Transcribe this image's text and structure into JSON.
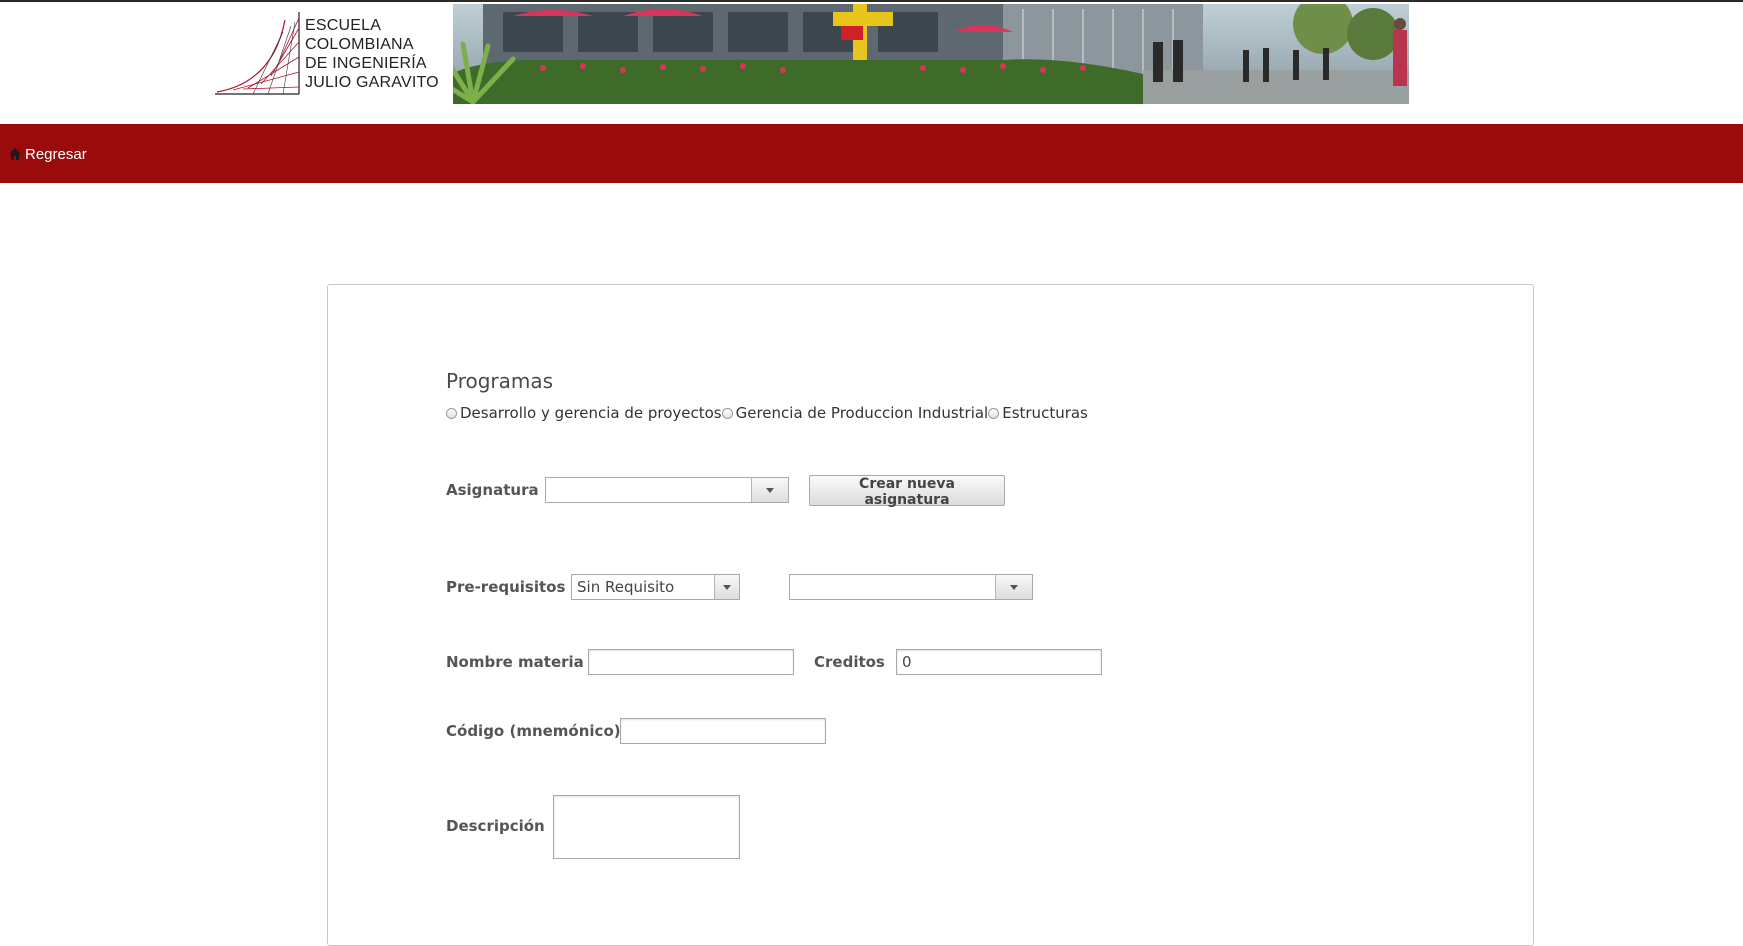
{
  "header": {
    "logo_lines": [
      "ESCUELA",
      "COLOMBIANA",
      "DE INGENIERÍA",
      "JULIO GARAVITO"
    ],
    "logo_alt": "Escuela Colombiana de Ingeniería Julio Garavito",
    "banner_icon": "campus-photo"
  },
  "nav": {
    "back_label": "Regresar",
    "back_icon": "home-icon",
    "bar_color": "#9a0b0b"
  },
  "form": {
    "programs_title": "Programas",
    "programs": [
      {
        "label": "Desarrollo y gerencia de proyectos",
        "checked": false
      },
      {
        "label": "Gerencia de Produccion Industrial",
        "checked": false
      },
      {
        "label": "Estructuras",
        "checked": false
      }
    ],
    "asignatura": {
      "label": "Asignatura",
      "value": "",
      "create_button": "Crear nueva asignatura"
    },
    "prerequisitos": {
      "label": "Pre-requisitos",
      "value": "Sin Requisito",
      "second_value": ""
    },
    "nombre_materia": {
      "label": "Nombre materia",
      "value": ""
    },
    "creditos": {
      "label": "Creditos",
      "value": "0"
    },
    "codigo": {
      "label": "Código (mnemónico)",
      "value": ""
    },
    "descripcion": {
      "label": "Descripción",
      "value": ""
    }
  }
}
